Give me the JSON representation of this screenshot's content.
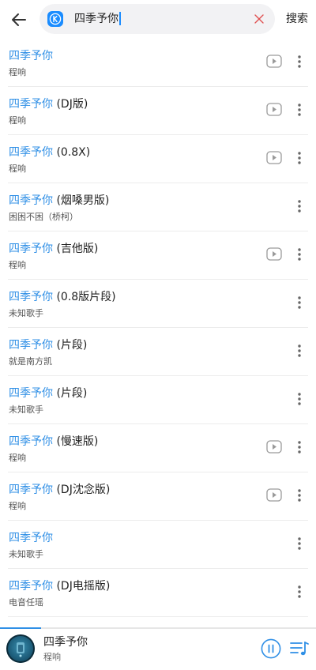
{
  "search": {
    "query": "四季予你",
    "action_label": "搜索"
  },
  "colors": {
    "accent": "#2f8fe6",
    "logo": "#1a8cff",
    "clear": "#e05050"
  },
  "icons": {
    "back": "back-arrow-icon",
    "logo": "kugou-logo-icon",
    "clear": "clear-x-icon",
    "mv": "play-video-icon",
    "more": "more-vertical-icon",
    "pause": "pause-icon",
    "playlist": "playlist-icon"
  },
  "results": [
    {
      "highlight": "四季予你",
      "suffix": "",
      "artist": "程响",
      "has_mv": true
    },
    {
      "highlight": "四季予你",
      "suffix": " (DJ版)",
      "artist": "程响",
      "has_mv": true
    },
    {
      "highlight": "四季予你",
      "suffix": " (0.8X)",
      "artist": "程响",
      "has_mv": true
    },
    {
      "highlight": "四季予你",
      "suffix": " (烟嗓男版)",
      "artist": "困困不困（桥柯）",
      "has_mv": false
    },
    {
      "highlight": "四季予你",
      "suffix": " (吉他版)",
      "artist": "程响",
      "has_mv": true
    },
    {
      "highlight": "四季予你",
      "suffix": " (0.8版片段)",
      "artist": "未知歌手",
      "has_mv": false
    },
    {
      "highlight": "四季予你",
      "suffix": " (片段)",
      "artist": "就是南方凯",
      "has_mv": false
    },
    {
      "highlight": "四季予你",
      "suffix": " (片段)",
      "artist": "未知歌手",
      "has_mv": false
    },
    {
      "highlight": "四季予你",
      "suffix": " (慢速版)",
      "artist": "程响",
      "has_mv": true
    },
    {
      "highlight": "四季予你",
      "suffix": " (DJ沈念版)",
      "artist": "程响",
      "has_mv": true
    },
    {
      "highlight": "四季予你",
      "suffix": "",
      "artist": "未知歌手",
      "has_mv": false
    },
    {
      "highlight": "四季予你",
      "suffix": " (DJ电摇版)",
      "artist": "电音任瑶",
      "has_mv": false
    }
  ],
  "player": {
    "title": "四季予你",
    "artist": "程响",
    "progress": 0.13
  }
}
